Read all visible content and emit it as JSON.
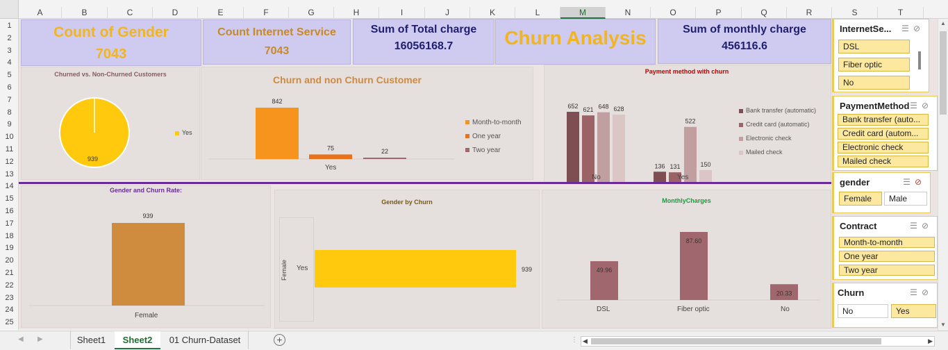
{
  "columns": [
    "A",
    "B",
    "C",
    "D",
    "E",
    "F",
    "G",
    "H",
    "I",
    "J",
    "K",
    "L",
    "M",
    "N",
    "O",
    "P",
    "Q",
    "R",
    "S",
    "T"
  ],
  "selected_column": "M",
  "rows": [
    "1",
    "2",
    "3",
    "4",
    "5",
    "6",
    "7",
    "8",
    "9",
    "10",
    "11",
    "12",
    "13",
    "14",
    "15",
    "16",
    "17",
    "18",
    "19",
    "20",
    "21",
    "22",
    "23",
    "24",
    "25"
  ],
  "kpis": {
    "gender": {
      "label": "Count of Gender",
      "value": "7043"
    },
    "internet": {
      "label": "Count Internet Service",
      "value": "7043"
    },
    "total_charge": {
      "label": "Sum of Total charge",
      "value": "16056168.7"
    },
    "title": "Churn Analysis",
    "monthly": {
      "label": "Sum of monthly charge",
      "value": "456116.6"
    }
  },
  "charts": {
    "pie": {
      "title": "Churned vs. Non-Churned Customers",
      "legend": "Yes",
      "data_label": "939"
    },
    "contract": {
      "title": "Churn and non Churn Customer",
      "xlabel": "Yes",
      "legend": [
        "Month-to-month",
        "One year",
        "Two year"
      ]
    },
    "payment": {
      "title": "Payment method with churn",
      "legend": [
        "Bank transfer (automatic)",
        "Credit card (automatic)",
        "Electronic check",
        "Mailed check"
      ],
      "groups": [
        "No",
        "Yes"
      ]
    },
    "gender_rate": {
      "title": "Gender and Churn Rate:",
      "category": "Female",
      "value_label": "939"
    },
    "gender_churn": {
      "title": "Gender by Churn",
      "outer": "Female",
      "inner": "Yes",
      "value_label": "939"
    },
    "monthly": {
      "title": "MonthlyCharges",
      "categories": [
        "DSL",
        "Fiber optic",
        "No"
      ]
    }
  },
  "chart_data": [
    {
      "type": "pie",
      "title": "Churned vs. Non-Churned Customers",
      "labels": [
        "Yes"
      ],
      "values": [
        939
      ]
    },
    {
      "type": "bar",
      "title": "Churn and non Churn Customer",
      "categories": [
        "Yes"
      ],
      "series": [
        {
          "name": "Month-to-month",
          "values": [
            842
          ]
        },
        {
          "name": "One year",
          "values": [
            75
          ]
        },
        {
          "name": "Two year",
          "values": [
            22
          ]
        }
      ],
      "xlabel": "Yes",
      "legend": "right"
    },
    {
      "type": "bar",
      "title": "Payment method with churn",
      "categories": [
        "No",
        "Yes"
      ],
      "series": [
        {
          "name": "Bank transfer (automatic)",
          "values": [
            652,
            136
          ]
        },
        {
          "name": "Credit card (automatic)",
          "values": [
            621,
            131
          ]
        },
        {
          "name": "Electronic check",
          "values": [
            648,
            522
          ]
        },
        {
          "name": "Mailed check",
          "values": [
            628,
            150
          ]
        }
      ],
      "legend": "right"
    },
    {
      "type": "bar",
      "title": "Gender and Churn Rate:",
      "categories": [
        "Female"
      ],
      "values": [
        939
      ]
    },
    {
      "type": "bar",
      "title": "Gender by Churn",
      "orientation": "horizontal",
      "categories": [
        "Yes"
      ],
      "values": [
        939
      ]
    },
    {
      "type": "bar",
      "title": "MonthlyCharges",
      "categories": [
        "DSL",
        "Fiber optic",
        "No"
      ],
      "values": [
        49.96,
        87.6,
        20.33
      ],
      "labels": [
        "49.96",
        "87.60",
        "20.33"
      ]
    }
  ],
  "colors": {
    "yellow": "#ffc90e",
    "orange": "#f7941d",
    "orange2": "#e8731c",
    "mauve": "#a0686e",
    "brown1": "#7e4e52",
    "brown2": "#9c6366",
    "pink": "#c19e9f",
    "pink2": "#dcc6c5",
    "gold": "#cf8c3f",
    "kpi_text": "#1f1f6e",
    "kpi_gold": "#f0b520"
  },
  "slicers": {
    "internet": {
      "title": "InternetSe...",
      "items": [
        {
          "label": "DSL",
          "on": true
        },
        {
          "label": "Fiber optic",
          "on": true
        },
        {
          "label": "No",
          "on": true
        }
      ]
    },
    "payment": {
      "title": "PaymentMethod",
      "items": [
        {
          "label": "Bank transfer (auto...",
          "on": true
        },
        {
          "label": "Credit card (autom...",
          "on": true
        },
        {
          "label": "Electronic check",
          "on": true
        },
        {
          "label": "Mailed check",
          "on": true
        }
      ]
    },
    "gender": {
      "title": "gender",
      "items": [
        {
          "label": "Female",
          "on": true
        },
        {
          "label": "Male",
          "on": false
        }
      ]
    },
    "contract": {
      "title": "Contract",
      "items": [
        {
          "label": "Month-to-month",
          "on": true
        },
        {
          "label": "One year",
          "on": true
        },
        {
          "label": "Two year",
          "on": true
        }
      ]
    },
    "churn": {
      "title": "Churn",
      "items": [
        {
          "label": "No",
          "on": false
        },
        {
          "label": "Yes",
          "on": true
        }
      ]
    }
  },
  "tabs": [
    "Sheet1",
    "Sheet2",
    "01 Churn-Dataset"
  ],
  "active_tab": "Sheet2"
}
